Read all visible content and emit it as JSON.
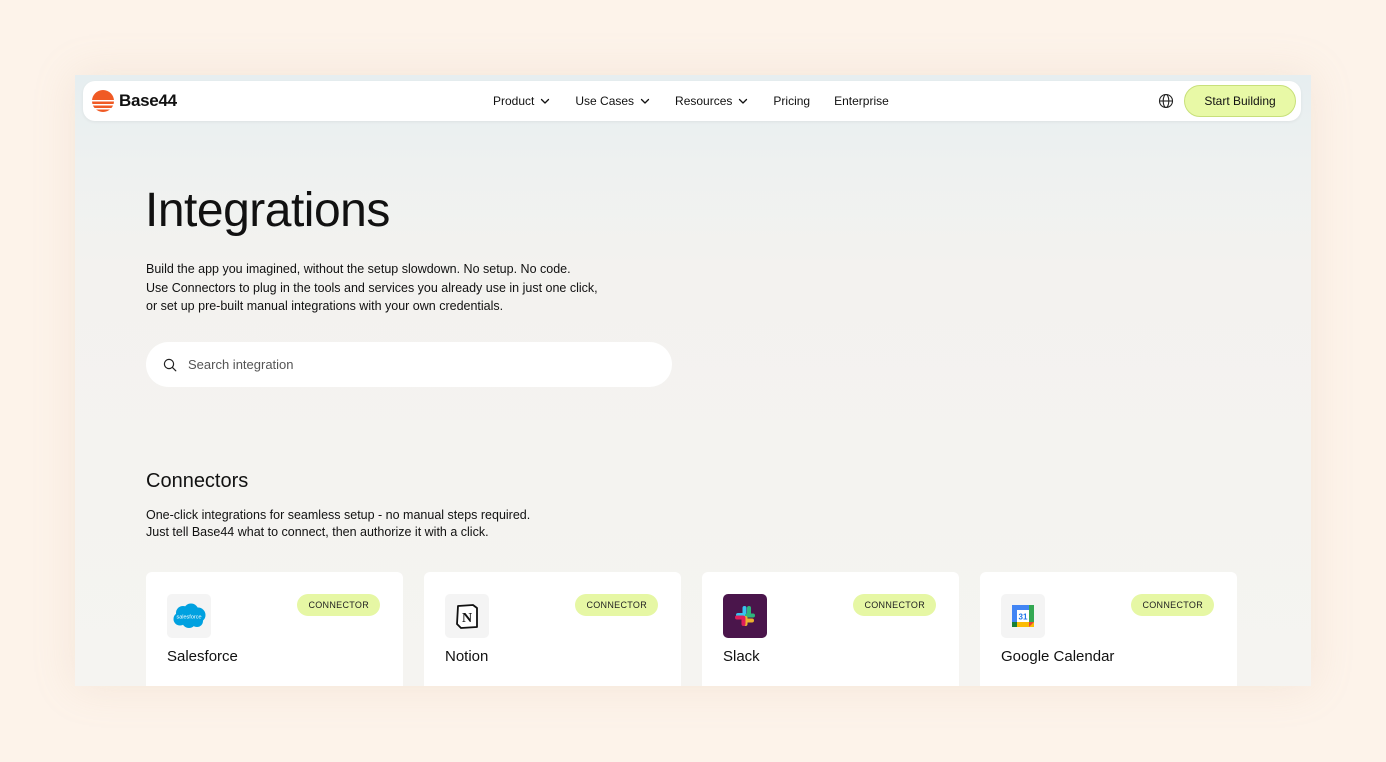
{
  "brand": {
    "name": "Base44",
    "accent": "#f05a24"
  },
  "nav": {
    "links": [
      {
        "label": "Product",
        "has_dropdown": true
      },
      {
        "label": "Use Cases",
        "has_dropdown": true
      },
      {
        "label": "Resources",
        "has_dropdown": true
      },
      {
        "label": "Pricing",
        "has_dropdown": false
      },
      {
        "label": "Enterprise",
        "has_dropdown": false
      }
    ],
    "language_icon": "globe-icon",
    "cta_label": "Start Building",
    "cta_color": "#e8f9a6"
  },
  "hero": {
    "title": "Integrations",
    "description_lines": [
      "Build the app you imagined, without the setup slowdown. No setup. No code.",
      "Use Connectors to plug in the tools and services you already use in just one click,",
      "or set up pre-built manual integrations with your own credentials."
    ]
  },
  "search": {
    "placeholder": "Search integration",
    "value": "",
    "icon": "search-icon"
  },
  "connectors": {
    "title": "Connectors",
    "description_lines": [
      "One-click integrations for seamless setup - no manual steps required.",
      "Just tell Base44 what to connect, then authorize it with a click."
    ],
    "cards": [
      {
        "name": "Salesforce",
        "badge": "CONNECTOR",
        "icon": "salesforce-logo-icon",
        "logo_text": "salesforce"
      },
      {
        "name": "Notion",
        "badge": "CONNECTOR",
        "icon": "notion-logo-icon",
        "logo_text": "N"
      },
      {
        "name": "Slack",
        "badge": "CONNECTOR",
        "icon": "slack-logo-icon"
      },
      {
        "name": "Google Calendar",
        "badge": "CONNECTOR",
        "icon": "google-calendar-logo-icon",
        "logo_text": "31"
      }
    ],
    "badge_color": "#e6f7a4"
  }
}
